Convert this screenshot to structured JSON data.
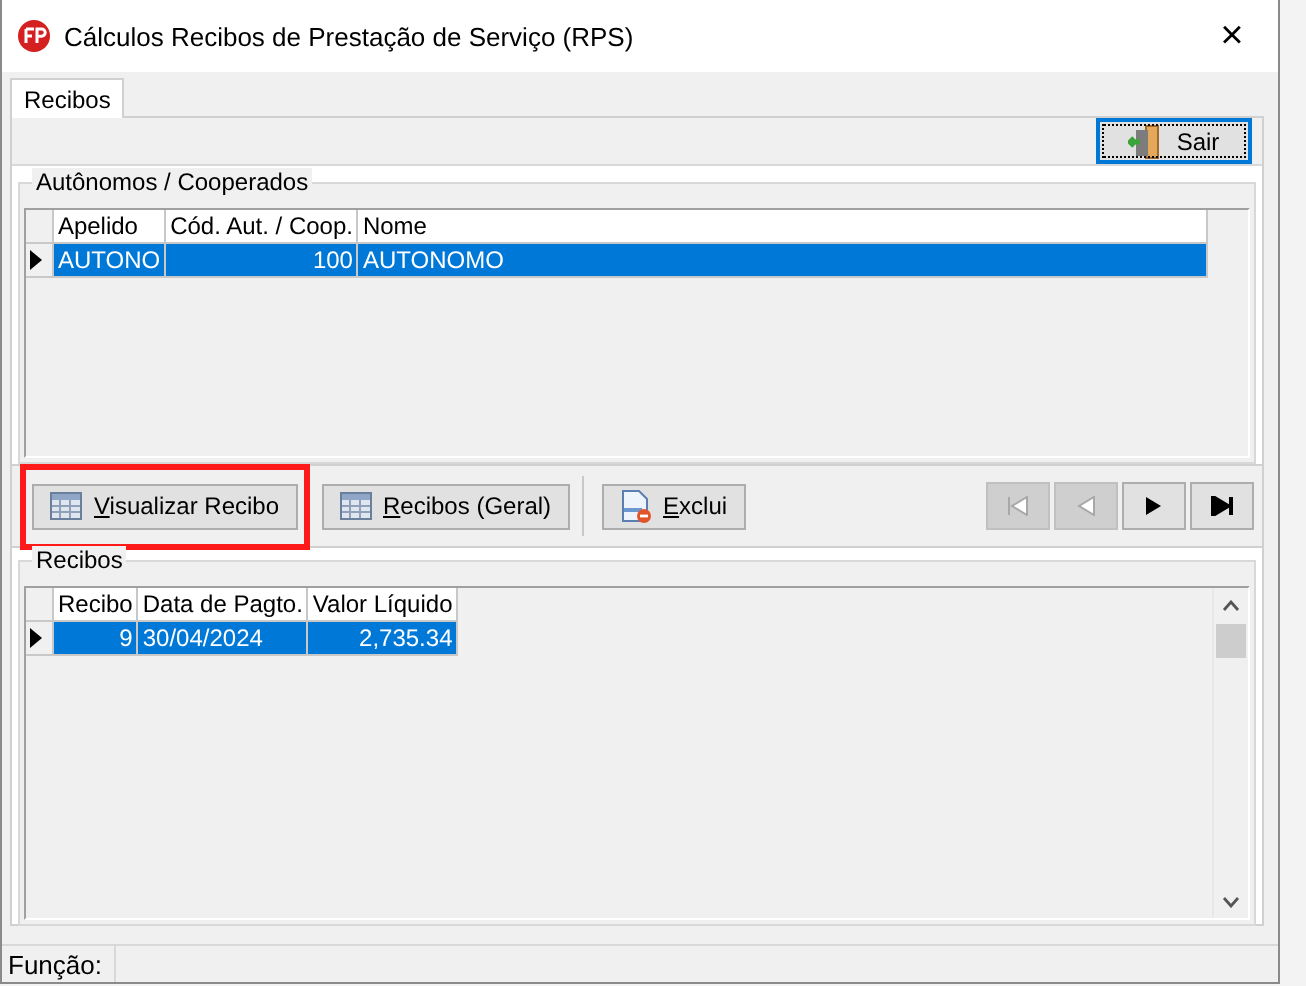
{
  "window": {
    "title": "Cálculos Recibos de Prestação de Serviço (RPS)",
    "close": "×"
  },
  "tabs": [
    {
      "label": "Recibos",
      "selected": true
    }
  ],
  "top_button": {
    "label": "Sair"
  },
  "autonomos": {
    "title": "Autônomos / Cooperados",
    "columns": [
      {
        "label": "Apelido"
      },
      {
        "label": "Cód. Aut. / Coop."
      },
      {
        "label": "Nome"
      }
    ],
    "rows": [
      {
        "selected": true,
        "cells": [
          "AUTONO",
          "100",
          "AUTONOMO"
        ]
      }
    ]
  },
  "toolbar": [
    {
      "label": "Visualizar Recibo",
      "kind": "view",
      "accelerator": true,
      "highlighted": true
    },
    {
      "label": "Recibos (Geral)",
      "kind": "list",
      "accelerator": true,
      "highlighted": false
    },
    {
      "label": "Exclui",
      "kind": "delete",
      "accelerator": true,
      "highlighted": false
    }
  ],
  "navigator": [
    {
      "kind": "first",
      "disabled": true
    },
    {
      "kind": "prior",
      "disabled": true
    },
    {
      "kind": "next",
      "disabled": false
    },
    {
      "kind": "last",
      "disabled": false
    }
  ],
  "recibos": {
    "title": "Recibos",
    "columns": [
      {
        "label": "Recibo"
      },
      {
        "label": "Data de Pagto."
      },
      {
        "label": "Valor Líquido"
      }
    ],
    "rows": [
      {
        "selected": true,
        "cells": [
          "9",
          "30/04/2024",
          "2,735.34"
        ]
      }
    ]
  },
  "status_bar": {
    "label": "Função:"
  }
}
